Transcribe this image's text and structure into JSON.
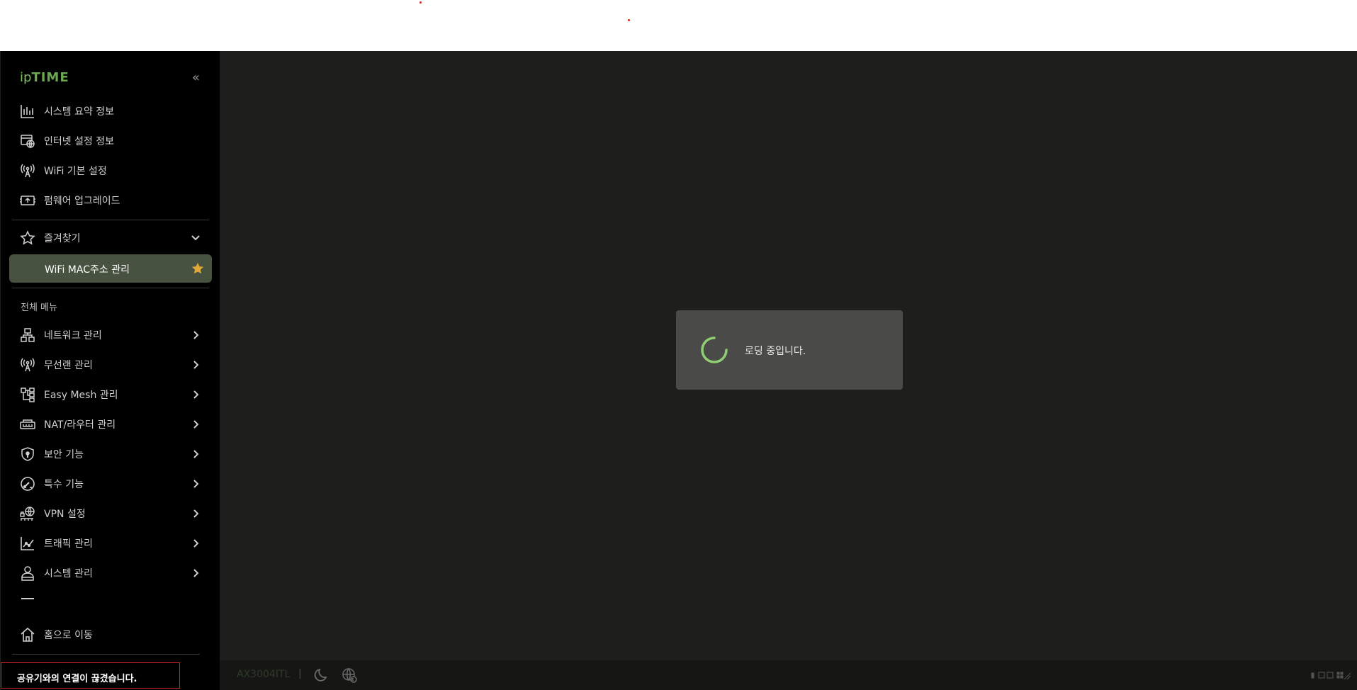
{
  "app": {
    "logo_prefix": "ip",
    "logo_main": "TIME",
    "collapse_glyph": "«"
  },
  "sidebar": {
    "quick_items": [
      {
        "label": "시스템 요약 정보",
        "icon": "bar-chart-icon"
      },
      {
        "label": "인터넷 설정 정보",
        "icon": "internet-settings-icon"
      },
      {
        "label": "WiFi 기본 설정",
        "icon": "wifi-antenna-icon"
      },
      {
        "label": "펌웨어 업그레이드",
        "icon": "firmware-icon"
      }
    ],
    "favorites": {
      "label": "즐겨찾기",
      "active_item": "WiFi MAC주소 관리"
    },
    "all_menu_label": "전체 메뉴",
    "menu_items": [
      {
        "label": "네트워크 관리",
        "icon": "network-icon"
      },
      {
        "label": "무선랜 관리",
        "icon": "wireless-icon"
      },
      {
        "label": "Easy Mesh 관리",
        "icon": "mesh-icon"
      },
      {
        "label": "NAT/라우터 관리",
        "icon": "router-icon"
      },
      {
        "label": "보안 기능",
        "icon": "shield-icon"
      },
      {
        "label": "특수 기능",
        "icon": "gauge-icon"
      },
      {
        "label": "VPN 설정",
        "icon": "vpn-icon"
      },
      {
        "label": "트래픽 관리",
        "icon": "traffic-icon"
      },
      {
        "label": "시스템 관리",
        "icon": "system-user-icon"
      }
    ],
    "home_label": "홈으로 이동"
  },
  "main": {
    "loading_text": "로딩 중입니다."
  },
  "footer": {
    "model": "AX3004ITL",
    "separator": "|"
  },
  "toast": {
    "message": "공유기와의 연결이 끊겼습니다."
  },
  "colors": {
    "accent": "#6aa84f",
    "sidebar_bg": "#000000",
    "main_bg": "#1e1f1c",
    "active_bg": "#475240",
    "star": "#e0a93a"
  }
}
